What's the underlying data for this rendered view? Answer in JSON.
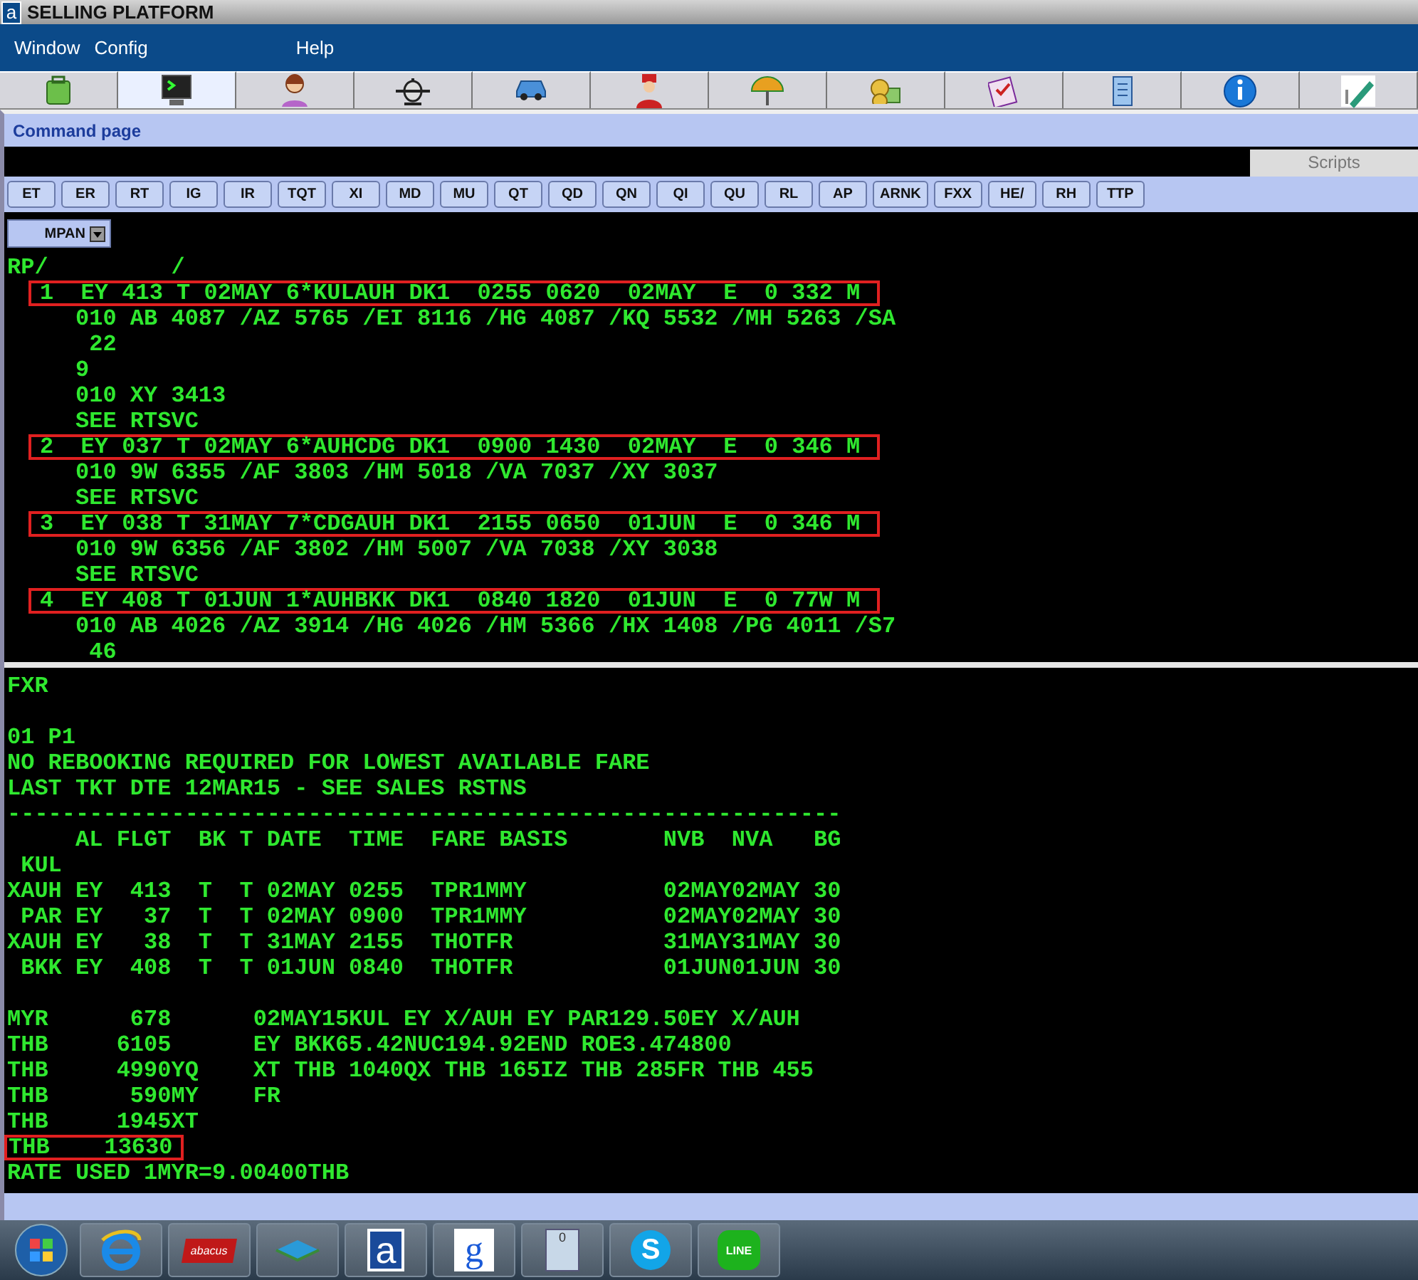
{
  "window": {
    "logo": "a",
    "title": "SELLING PLATFORM"
  },
  "menu": [
    "Window",
    "Config",
    "Help"
  ],
  "toolbar_tabs": [
    {
      "selected": false
    },
    {
      "selected": true
    },
    {
      "selected": false
    },
    {
      "selected": false
    },
    {
      "selected": false
    },
    {
      "selected": false
    },
    {
      "selected": false
    },
    {
      "selected": false
    },
    {
      "selected": false
    },
    {
      "selected": false
    },
    {
      "selected": false
    },
    {
      "selected": false
    }
  ],
  "page_title": "Command page",
  "scripts_tab": "Scripts",
  "command_buttons": [
    "ET",
    "ER",
    "RT",
    "IG",
    "IR",
    "TQT",
    "XI",
    "MD",
    "MU",
    "QT",
    "QD",
    "QN",
    "QI",
    "QU",
    "RL",
    "AP",
    "ARNK",
    "FXX",
    "HE/",
    "RH",
    "TTP"
  ],
  "mode_dropdown": "MPAN",
  "upper_terminal": [
    {
      "text": "RP/         /",
      "highlighted": false
    },
    {
      "text": "1  EY 413 T 02MAY 6*KULAUH DK1  0255 0620  02MAY  E  0 332 M",
      "highlighted": true
    },
    {
      "text": "     010 AB 4087 /AZ 5765 /EI 8116 /HG 4087 /KQ 5532 /MH 5263 /SA",
      "highlighted": false
    },
    {
      "text": "      22",
      "highlighted": false
    },
    {
      "text": "     9",
      "highlighted": false
    },
    {
      "text": "     010 XY 3413",
      "highlighted": false
    },
    {
      "text": "     SEE RTSVC",
      "highlighted": false
    },
    {
      "text": "2  EY 037 T 02MAY 6*AUHCDG DK1  0900 1430  02MAY  E  0 346 M",
      "highlighted": true
    },
    {
      "text": "     010 9W 6355 /AF 3803 /HM 5018 /VA 7037 /XY 3037",
      "highlighted": false
    },
    {
      "text": "     SEE RTSVC",
      "highlighted": false
    },
    {
      "text": "3  EY 038 T 31MAY 7*CDGAUH DK1  2155 0650  01JUN  E  0 346 M",
      "highlighted": true
    },
    {
      "text": "     010 9W 6356 /AF 3802 /HM 5007 /VA 7038 /XY 3038",
      "highlighted": false
    },
    {
      "text": "     SEE RTSVC",
      "highlighted": false
    },
    {
      "text": "4  EY 408 T 01JUN 1*AUHBKK DK1  0840 1820  01JUN  E  0 77W M",
      "highlighted": true
    },
    {
      "text": "     010 AB 4026 /AZ 3914 /HG 4026 /HM 5366 /HX 1408 /PG 4011 /S7",
      "highlighted": false
    },
    {
      "text": "      46",
      "highlighted": false
    }
  ],
  "lower_terminal": [
    {
      "text": "FXR",
      "highlighted": false
    },
    {
      "text": "01 P1",
      "highlighted": false
    },
    {
      "text": "NO REBOOKING REQUIRED FOR LOWEST AVAILABLE FARE",
      "highlighted": false
    },
    {
      "text": "LAST TKT DTE 12MAR15 - SEE SALES RSTNS",
      "highlighted": false
    },
    {
      "text": "-------------------------------------------------------------",
      "highlighted": false
    },
    {
      "text": "     AL FLGT  BK T DATE  TIME  FARE BASIS       NVB  NVA   BG",
      "highlighted": false
    },
    {
      "text": " KUL",
      "highlighted": false
    },
    {
      "text": "XAUH EY  413  T  T 02MAY 0255  TPR1MMY          02MAY02MAY 30",
      "highlighted": false
    },
    {
      "text": " PAR EY   37  T  T 02MAY 0900  TPR1MMY          02MAY02MAY 30",
      "highlighted": false
    },
    {
      "text": "XAUH EY   38  T  T 31MAY 2155  THOTFR           31MAY31MAY 30",
      "highlighted": false
    },
    {
      "text": " BKK EY  408  T  T 01JUN 0840  THOTFR           01JUN01JUN 30",
      "highlighted": false
    },
    {
      "text": "MYR      678      02MAY15KUL EY X/AUH EY PAR129.50EY X/AUH",
      "highlighted": false
    },
    {
      "text": "THB     6105      EY BKK65.42NUC194.92END ROE3.474800",
      "highlighted": false
    },
    {
      "text": "THB     4990YQ    XT THB 1040QX THB 165IZ THB 285FR THB 455",
      "highlighted": false
    },
    {
      "text": "THB      590MY    FR",
      "highlighted": false
    },
    {
      "text": "THB     1945XT",
      "highlighted": false
    },
    {
      "text": "THB    13630",
      "highlighted": true
    },
    {
      "text": "RATE USED 1MYR=9.00400THB",
      "highlighted": false
    }
  ],
  "taskbar": [
    {
      "kind": "start"
    },
    {
      "kind": "browser"
    },
    {
      "kind": "abacus",
      "label": "abacus"
    },
    {
      "kind": "layers"
    },
    {
      "kind": "letter",
      "label": "a"
    },
    {
      "kind": "google",
      "label": "g"
    },
    {
      "kind": "calculator",
      "label": "0"
    },
    {
      "kind": "skype",
      "label": "S"
    },
    {
      "kind": "line",
      "label": "LINE"
    }
  ]
}
